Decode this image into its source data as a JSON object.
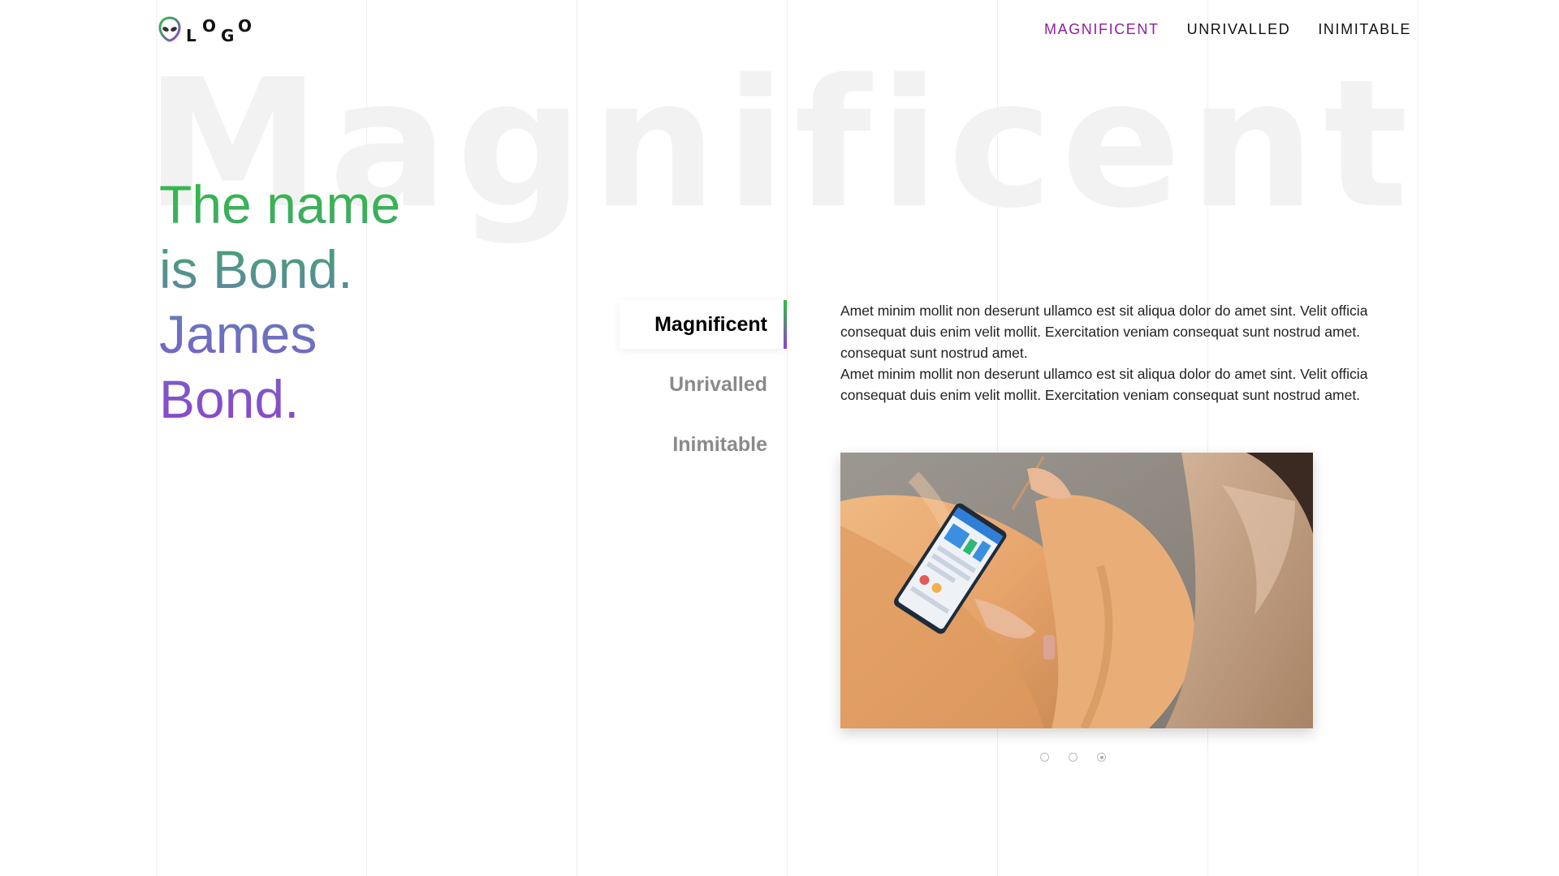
{
  "watermark": "Magnificent",
  "logo": {
    "letters": [
      "L",
      "O",
      "G",
      "O"
    ],
    "icon": "alien-head-icon"
  },
  "nav": [
    {
      "label": "MAGNIFICENT",
      "active": true
    },
    {
      "label": "UNRIVALLED",
      "active": false
    },
    {
      "label": "INIMITABLE",
      "active": false
    }
  ],
  "headline": {
    "lines": [
      "The name",
      "is Bond.",
      "James",
      "Bond."
    ]
  },
  "tabs": [
    {
      "label": "Magnificent",
      "active": true
    },
    {
      "label": "Unrivalled",
      "active": false
    },
    {
      "label": "Inimitable",
      "active": false
    }
  ],
  "content": {
    "paragraphs": [
      "Amet minim mollit non deserunt ullamco est sit aliqua dolor do amet sint. Velit officia consequat duis enim velit mollit. Exercitation veniam consequat sunt nostrud amet. consequat sunt nostrud amet.",
      "Amet minim mollit non deserunt ullamco est sit aliqua dolor do amet sint. Velit officia consequat duis enim velit mollit. Exercitation veniam consequat sunt nostrud amet."
    ],
    "image": "woman-using-tablet-photo"
  },
  "carousel": {
    "dots": 3,
    "active_index": 2
  },
  "colors": {
    "accent": "#8e1fa0",
    "gradient_start": "#2fbf3f",
    "gradient_end": "#8d43cc",
    "watermark": "#f2f2f2"
  }
}
